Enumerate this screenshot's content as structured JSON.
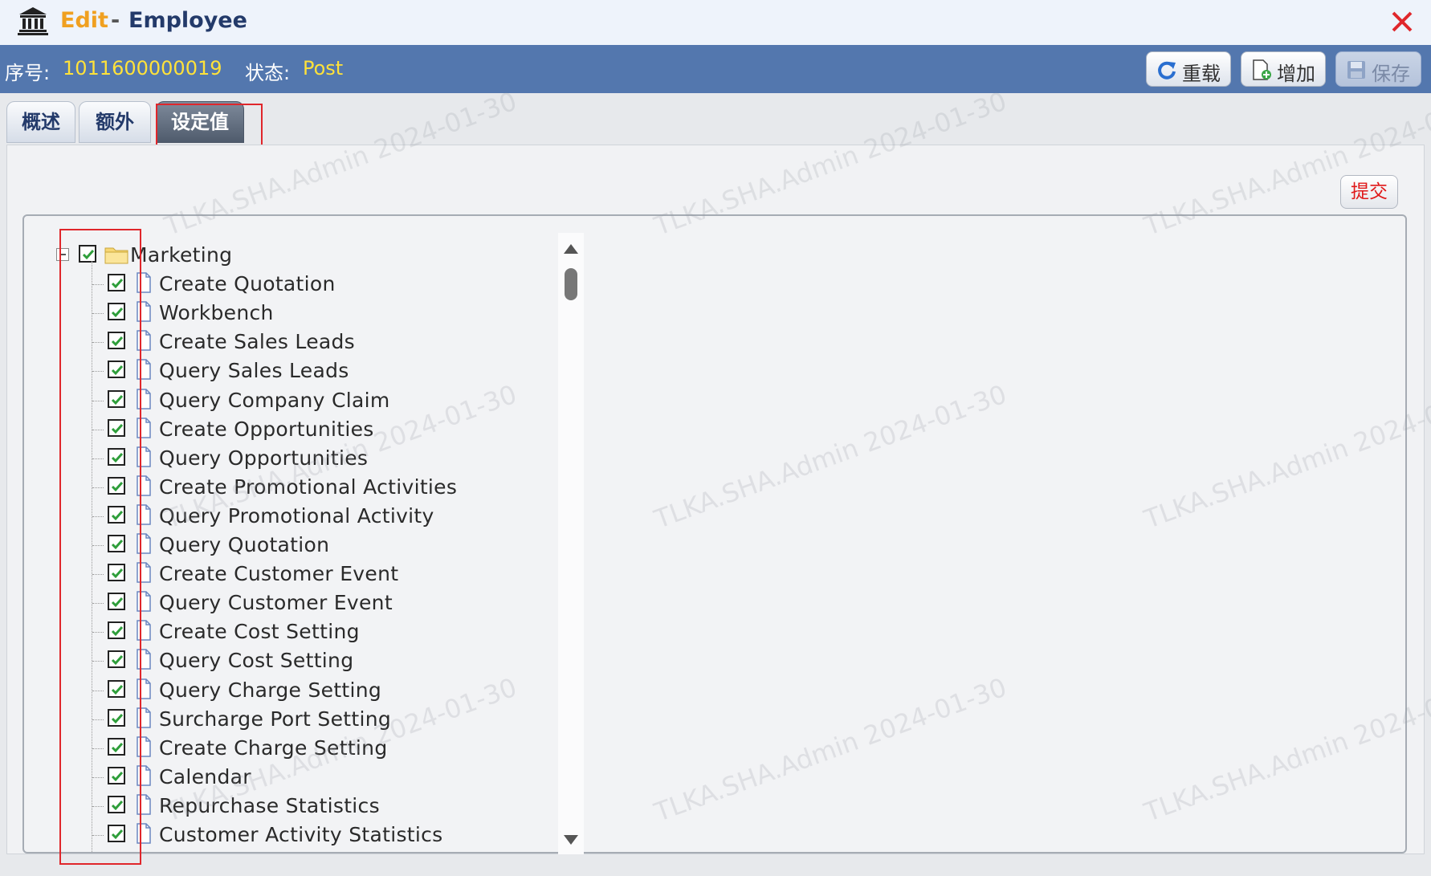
{
  "window": {
    "title_action": "Edit",
    "title_separator": "-",
    "title_entity": "Employee",
    "close_icon": "close-icon"
  },
  "info": {
    "serial_label": "序号:",
    "serial_value": "1011600000019",
    "status_label": "状态:",
    "status_value": "Post"
  },
  "toolbar": {
    "reload_label": "重载",
    "add_label": "增加",
    "save_label": "保存"
  },
  "tabs": [
    {
      "label": "概述",
      "active": false
    },
    {
      "label": "额外",
      "active": false
    },
    {
      "label": "设定值",
      "active": true
    }
  ],
  "submit_label": "提交",
  "tree": {
    "root": {
      "label": "Marketing",
      "checked": true,
      "expanded": true
    },
    "items": [
      {
        "label": "Create Quotation",
        "checked": true
      },
      {
        "label": "Workbench",
        "checked": true
      },
      {
        "label": "Create Sales Leads",
        "checked": true
      },
      {
        "label": "Query Sales Leads",
        "checked": true
      },
      {
        "label": "Query Company Claim",
        "checked": true
      },
      {
        "label": "Create Opportunities",
        "checked": true
      },
      {
        "label": "Query Opportunities",
        "checked": true
      },
      {
        "label": "Create Promotional Activities",
        "checked": true
      },
      {
        "label": "Query Promotional Activity",
        "checked": true
      },
      {
        "label": "Query Quotation",
        "checked": true
      },
      {
        "label": "Create Customer Event",
        "checked": true
      },
      {
        "label": "Query Customer Event",
        "checked": true
      },
      {
        "label": "Create Cost Setting",
        "checked": true
      },
      {
        "label": "Query Cost Setting",
        "checked": true
      },
      {
        "label": "Query Charge Setting",
        "checked": true
      },
      {
        "label": "Surcharge Port Setting",
        "checked": true
      },
      {
        "label": "Create Charge Setting",
        "checked": true
      },
      {
        "label": "Calendar",
        "checked": true
      },
      {
        "label": "Repurchase Statistics",
        "checked": true
      },
      {
        "label": "Customer Activity Statistics",
        "checked": true
      }
    ]
  },
  "watermark": "TLKA.SHA.Admin 2024-01-30",
  "colors": {
    "title_bg": "#eef3fb",
    "infobar_bg": "#5377ae",
    "highlight_yellow": "#ffe23a",
    "edit_orange": "#f0a020",
    "check_green": "#2e9e3a",
    "annotation_red": "#e0262b"
  }
}
